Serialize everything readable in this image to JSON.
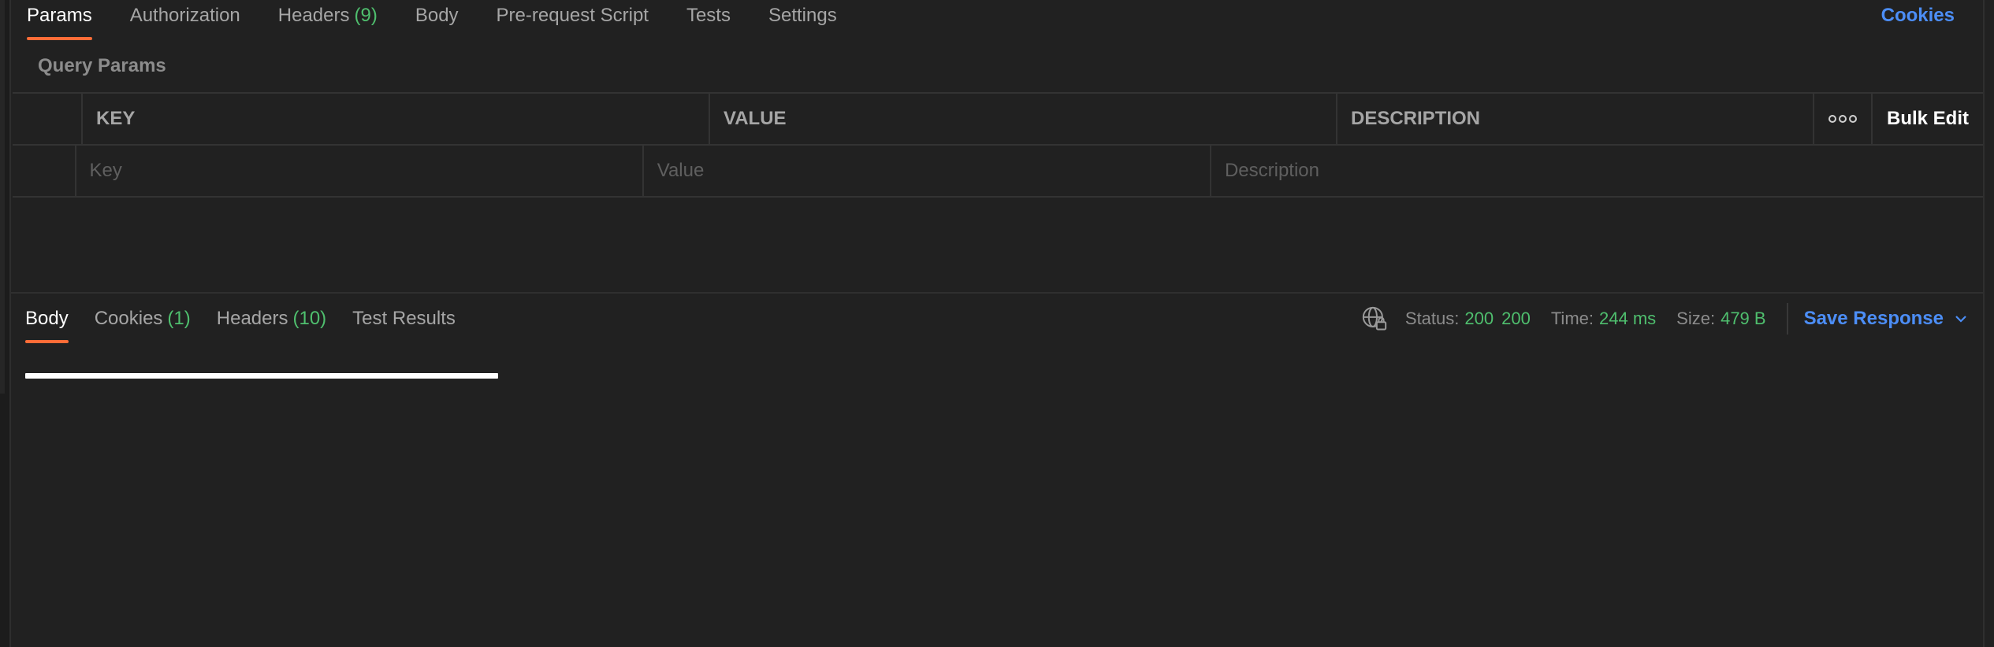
{
  "request": {
    "tabs": [
      {
        "label": "Params",
        "count": ""
      },
      {
        "label": "Authorization",
        "count": ""
      },
      {
        "label": "Headers",
        "count": "(9)"
      },
      {
        "label": "Body",
        "count": ""
      },
      {
        "label": "Pre-request Script",
        "count": ""
      },
      {
        "label": "Tests",
        "count": ""
      },
      {
        "label": "Settings",
        "count": ""
      }
    ],
    "active_tab": "Params",
    "cookies_link": "Cookies"
  },
  "query_params": {
    "title": "Query Params",
    "columns": {
      "key": "KEY",
      "value": "VALUE",
      "description": "DESCRIPTION"
    },
    "bulk_edit": "Bulk Edit",
    "placeholders": {
      "key": "Key",
      "value": "Value",
      "description": "Description"
    }
  },
  "response": {
    "tabs": [
      {
        "label": "Body",
        "count": ""
      },
      {
        "label": "Cookies",
        "count": "(1)"
      },
      {
        "label": "Headers",
        "count": "(10)"
      },
      {
        "label": "Test Results",
        "count": ""
      }
    ],
    "active_tab": "Body",
    "status_label": "Status:",
    "status_value": "200",
    "status_text": "200",
    "time_label": "Time:",
    "time_value": "244 ms",
    "size_label": "Size:",
    "size_value": "479 B",
    "save_response": "Save Response"
  },
  "icons": {
    "more": "more-horizontal-icon",
    "globe": "globe-lock-icon",
    "chevron": "chevron-down-icon"
  },
  "colors": {
    "background": "#212121",
    "accent": "#ff6c37",
    "link": "#4c8ef7",
    "success": "#4fbf6e"
  }
}
